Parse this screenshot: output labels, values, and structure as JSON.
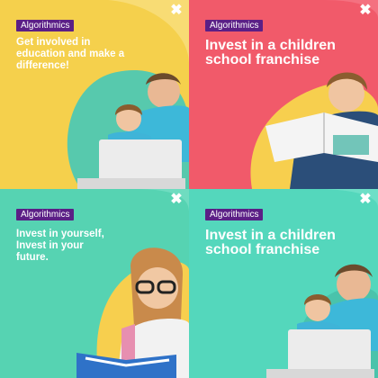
{
  "ads": [
    {
      "brand": "Algorithmics",
      "headline": "Get involved in\neducation and make a\ndifference!",
      "background": "#f5d04c",
      "close_glyph": "✖"
    },
    {
      "brand": "Algorithmics",
      "headline": "Invest in a children\nschool franchise",
      "background": "#f15a6a",
      "close_glyph": "✖"
    },
    {
      "brand": "Algorithmics",
      "headline": "Invest in yourself,\nInvest in your\nfuture.",
      "background": "#56d3b2",
      "close_glyph": "✖"
    },
    {
      "brand": "Algorithmics",
      "headline": "Invest in a children\nschool franchise",
      "background": "#54d7bc",
      "close_glyph": "✖"
    }
  ],
  "colors": {
    "brand_badge": "#5b1f86",
    "yellow": "#f5d04c",
    "coral": "#f15a6a",
    "teal": "#56d3b2"
  }
}
